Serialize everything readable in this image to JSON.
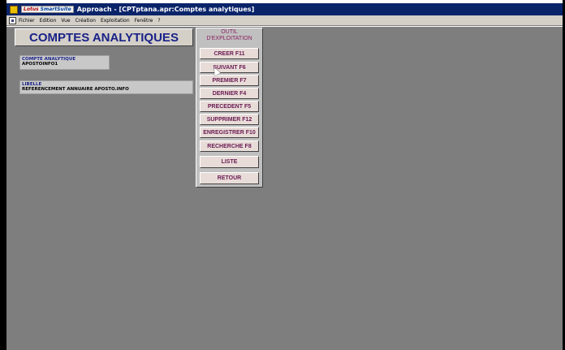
{
  "window": {
    "suite_logo_lotus": "Lotus",
    "suite_logo_smart": "SmartSuite",
    "title": "Approach - [CPTptana.apr:Comptes analytiques]"
  },
  "menu": {
    "items": [
      "Fichier",
      "Edition",
      "Vue",
      "Création",
      "Exploitation",
      "Fenêtre",
      "?"
    ]
  },
  "form": {
    "title": "COMPTES ANALYTIQUES",
    "code_label": "COMPTE ANALYTIQUE",
    "code_value": "APOSTOINFO1",
    "libelle_label": "LIBELLE",
    "libelle_value": "REFERENCEMENT ANNUAIRE APOSTO.INFO"
  },
  "tools": {
    "title_line1": "OUTIL",
    "title_line2": "D'EXPLOITATION",
    "buttons": [
      "CREER F11",
      "SUIVANT F6",
      "PREMIER F7",
      "DERNIER F4",
      "PRECEDENT F5",
      "SUPPRIMER F12",
      "ENREGISTRER F10",
      "RECHERCHE F8",
      "LISTE",
      "RETOUR"
    ]
  },
  "colors": {
    "titlebar": "#0a246a",
    "workspace": "#7e7e7e",
    "header_text": "#1a2288",
    "button_text": "#6a1a52"
  }
}
